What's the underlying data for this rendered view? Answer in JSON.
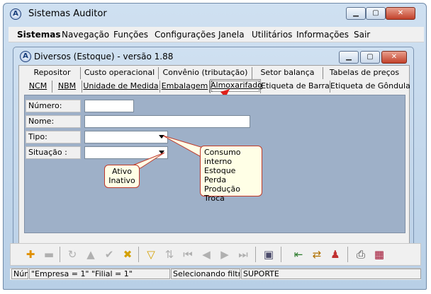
{
  "window": {
    "title": "Sistemas Auditor",
    "icon": "A"
  },
  "menu": [
    "Sistemas",
    "Navegação",
    "Funções",
    "Configurações",
    "Janela",
    "Utilitários",
    "Informações",
    "Sair"
  ],
  "inner": {
    "title": "Diversos (Estoque) - versão 1.88",
    "icon": "A"
  },
  "tabs_row1": [
    "Repositor",
    "Custo operacional",
    "Convênio (tributação)",
    "Setor balança",
    "Tabelas de preços"
  ],
  "tabs_row2": [
    "NCM",
    "NBM",
    "Unidade de Medida",
    "Embalagem",
    "Almoxarifado",
    "Etiqueta de Barra",
    "Etiqueta de Gôndula"
  ],
  "form": {
    "numero_label": "Número:",
    "nome_label": "Nome:",
    "tipo_label": "Tipo:",
    "situacao_label": "Situação :"
  },
  "callout_tipo": [
    "Consumo interno",
    "Estoque",
    "Perda",
    "Produção",
    "Troca"
  ],
  "callout_situacao": [
    "Ativo",
    "Inativo"
  ],
  "status": {
    "p1": "Núm",
    "p2": "\"Empresa = 1\"   \"Filial = 1\"",
    "p3": "Selecionando filtro",
    "p4": "SUPORTE"
  },
  "colors": {
    "accent_red": "#e0201a",
    "panel": "#9eb0c8"
  }
}
